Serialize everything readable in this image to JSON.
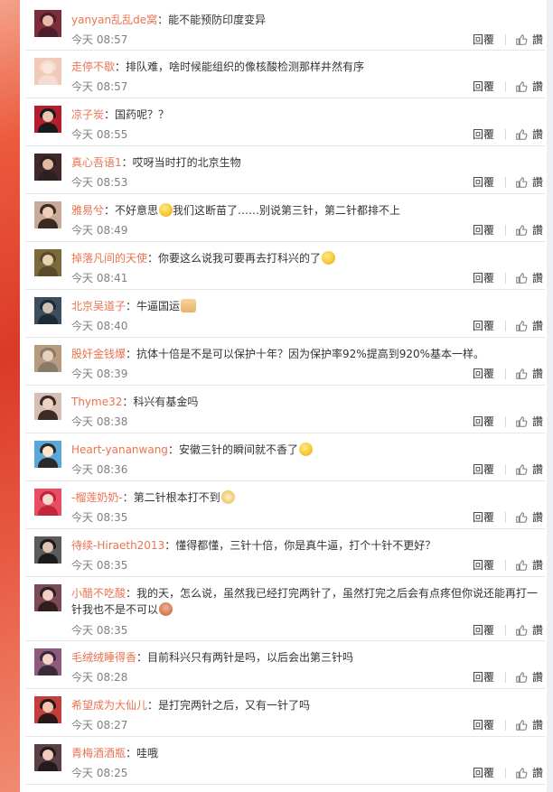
{
  "actions": {
    "reply_label": "回覆",
    "like_label": "讚"
  },
  "comments": [
    {
      "user": "yanyan乱乱de窝",
      "text": "能不能预防印度变异",
      "time": "今天 08:57"
    },
    {
      "user": "走停不歇",
      "text": "排队难，啥时候能组织的像核酸检测那样井然有序",
      "time": "今天 08:57"
    },
    {
      "user": "凉子炭",
      "text": "国药呢？？",
      "time": "今天 08:55"
    },
    {
      "user": "真心吾语1",
      "text": "哎呀当时打的北京生物",
      "time": "今天 08:53"
    },
    {
      "user": "雅易兮",
      "text": "不好意思",
      "text2": "我们这断苗了……别说第三针，第二针都排不上",
      "time": "今天 08:49"
    },
    {
      "user": "掉落凡间的天使",
      "text": "你要这么说我可要再去打科兴的了",
      "time": "今天 08:41"
    },
    {
      "user": "北京吴道子",
      "text": "牛逼国运",
      "time": "今天 08:40"
    },
    {
      "user": "股奸金钱爆",
      "text": "抗体十倍是不是可以保护十年？因为保护率92%提高到920%基本一样。",
      "time": "今天 08:39"
    },
    {
      "user": "Thyme32",
      "text": "科兴有基金吗",
      "time": "今天 08:38"
    },
    {
      "user": "Heart-yananwang",
      "text": "安徽三针的瞬间就不香了",
      "time": "今天 08:36"
    },
    {
      "user": "-榴莲奶奶-",
      "text": "第二针根本打不到",
      "time": "今天 08:35"
    },
    {
      "user": "待续-Hiraeth2013",
      "text": "懂得都懂，三针十倍，你是真牛逼，打个十针不更好？",
      "time": "今天 08:35"
    },
    {
      "user": "小醋不吃酸",
      "text": "我的天，怎么说，虽然我已经打完两针了，虽然打完之后会有点疼但你说还能再打一针我也不是不可以",
      "time": "今天 08:35"
    },
    {
      "user": "毛绒绒睡得香",
      "text": "目前科兴只有两针是吗，以后会出第三针吗",
      "time": "今天 08:28"
    },
    {
      "user": "希望成为大仙儿",
      "text": "是打完两针之后，又有一针了吗",
      "time": "今天 08:27"
    },
    {
      "user": "青梅酒酒瓶",
      "text": "哇哦",
      "time": "今天 08:25"
    }
  ]
}
